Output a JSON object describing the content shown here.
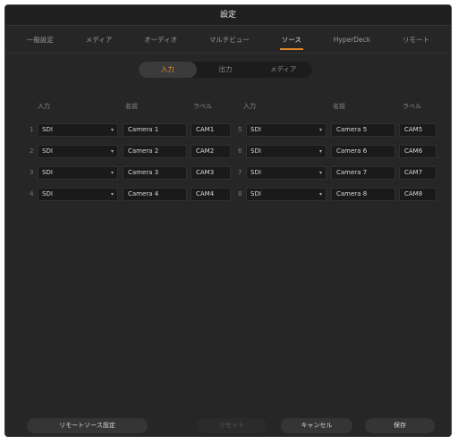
{
  "window": {
    "title": "設定"
  },
  "tabs": [
    {
      "label": "一般設定",
      "active": false
    },
    {
      "label": "メディア",
      "active": false
    },
    {
      "label": "オーディオ",
      "active": false
    },
    {
      "label": "マルチビュー",
      "active": false
    },
    {
      "label": "ソース",
      "active": true
    },
    {
      "label": "HyperDeck",
      "active": false
    },
    {
      "label": "リモート",
      "active": false
    }
  ],
  "segments": [
    {
      "label": "入力",
      "active": true
    },
    {
      "label": "出力",
      "active": false
    },
    {
      "label": "メディア",
      "active": false
    }
  ],
  "headers": {
    "input": "入力",
    "name": "名前",
    "label": "ラベル"
  },
  "left": [
    {
      "num": "1",
      "source": "SDI",
      "name": "Camera 1",
      "label": "CAM1"
    },
    {
      "num": "2",
      "source": "SDI",
      "name": "Camera 2",
      "label": "CAM2"
    },
    {
      "num": "3",
      "source": "SDI",
      "name": "Camera 3",
      "label": "CAM3"
    },
    {
      "num": "4",
      "source": "SDI",
      "name": "Camera 4",
      "label": "CAM4"
    }
  ],
  "right": [
    {
      "num": "5",
      "source": "SDI",
      "name": "Camera 5",
      "label": "CAM5"
    },
    {
      "num": "6",
      "source": "SDI",
      "name": "Camera 6",
      "label": "CAM6"
    },
    {
      "num": "7",
      "source": "SDI",
      "name": "Camera 7",
      "label": "CAM7"
    },
    {
      "num": "8",
      "source": "SDI",
      "name": "Camera 8",
      "label": "CAM8"
    }
  ],
  "footer": {
    "remote_source": "リモートソース設定",
    "reset": "リセット",
    "cancel": "キャンセル",
    "save": "保存"
  },
  "colors": {
    "accent": "#e5892a",
    "background": "#262626"
  }
}
